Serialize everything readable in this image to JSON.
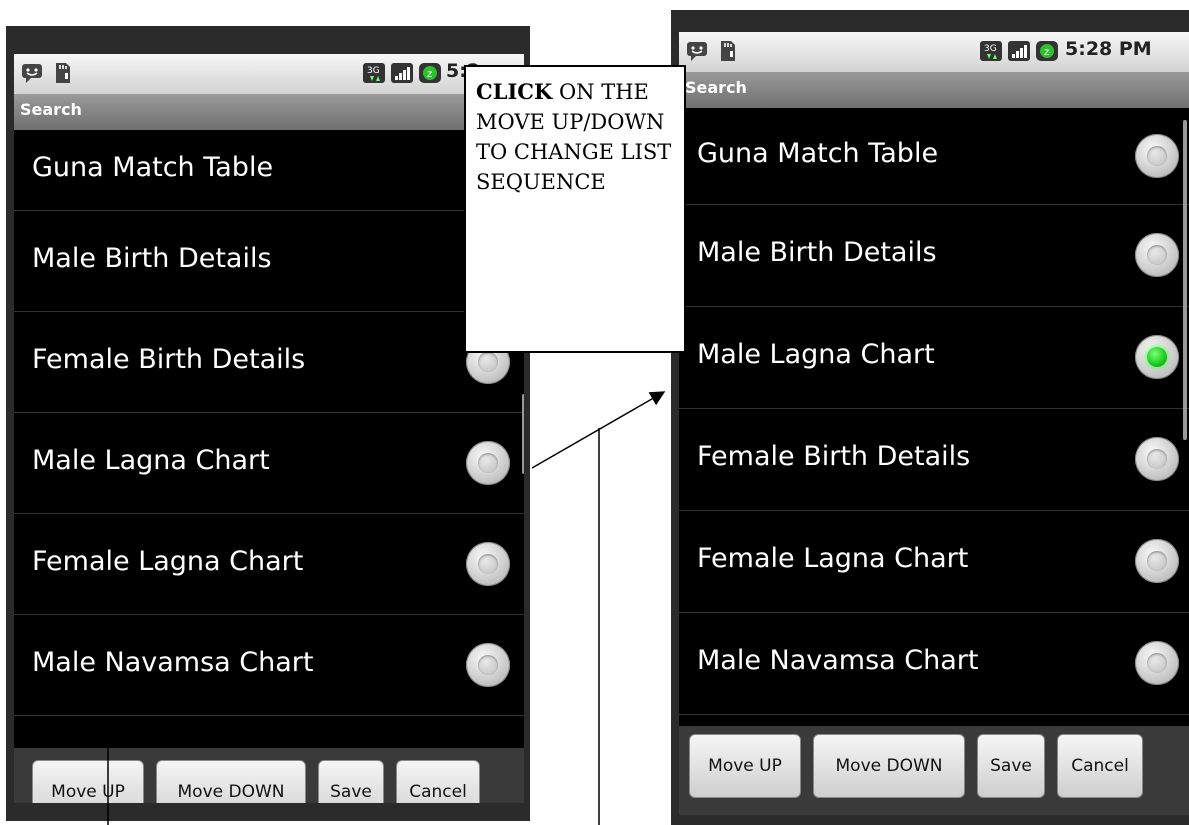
{
  "left_screen": {
    "status_time": "5:2",
    "title": "Search",
    "items": [
      {
        "label": "Guna Match Table",
        "has_radio": false,
        "checked": false
      },
      {
        "label": "Male Birth Details",
        "has_radio": false,
        "checked": false
      },
      {
        "label": "Female Birth Details",
        "has_radio": true,
        "checked": false
      },
      {
        "label": "Male Lagna Chart",
        "has_radio": true,
        "checked": false
      },
      {
        "label": "Female Lagna Chart",
        "has_radio": true,
        "checked": false
      },
      {
        "label": "Male Navamsa Chart",
        "has_radio": true,
        "checked": false
      }
    ],
    "buttons": {
      "move_up": "Move UP",
      "move_down": "Move DOWN",
      "save": "Save",
      "cancel": "Cancel"
    }
  },
  "right_screen": {
    "status_time": "5:28 PM",
    "title": "Search",
    "items": [
      {
        "label": "Guna Match Table",
        "has_radio": true,
        "checked": false
      },
      {
        "label": "Male Birth Details",
        "has_radio": true,
        "checked": false
      },
      {
        "label": "Male Lagna Chart",
        "has_radio": true,
        "checked": true
      },
      {
        "label": "Female Birth Details",
        "has_radio": true,
        "checked": false
      },
      {
        "label": "Female Lagna Chart",
        "has_radio": true,
        "checked": false
      },
      {
        "label": "Male Navamsa Chart",
        "has_radio": true,
        "checked": false
      }
    ],
    "buttons": {
      "move_up": "Move UP",
      "move_down": "Move DOWN",
      "save": "Save",
      "cancel": "Cancel"
    }
  },
  "callout": {
    "bold": "CLICK",
    "text": " ON THE MOVE UP/DOWN TO CHANGE LIST SEQUENCE"
  },
  "colors": {
    "selected_radio": "#17c917",
    "screen_bg": "#000000",
    "title_bar": "#7f7f7f"
  },
  "status_icons": [
    "chat-notification-icon",
    "sd-card-icon",
    "3g-data-icon",
    "signal-strength-icon",
    "battery-icon"
  ]
}
